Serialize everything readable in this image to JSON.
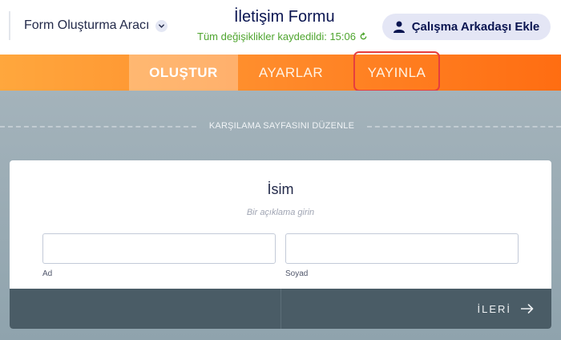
{
  "header": {
    "builder_name": "Form Oluşturma Aracı",
    "form_title": "İletişim Formu",
    "save_status": "Tüm değişiklikler kaydedildi: 15:06",
    "add_collaborator": "Çalışma Arkadaşı Ekle"
  },
  "tabs": [
    {
      "label": "OLUŞTUR",
      "active": true
    },
    {
      "label": "AYARLAR",
      "active": false
    },
    {
      "label": "YAYINLA",
      "active": false,
      "highlighted": true
    }
  ],
  "canvas": {
    "welcome_label": "KARŞILAMA SAYFASINI DÜZENLE"
  },
  "field": {
    "title": "İsim",
    "description_placeholder": "Bir açıklama girin",
    "first_label": "Ad",
    "last_label": "Soyad",
    "next_label": "İLERİ"
  },
  "colors": {
    "accent_orange": "#ff7b1f",
    "saved_green": "#4fa52f",
    "highlight_red": "#e63e3e",
    "footer_dark": "#4a5c66"
  }
}
